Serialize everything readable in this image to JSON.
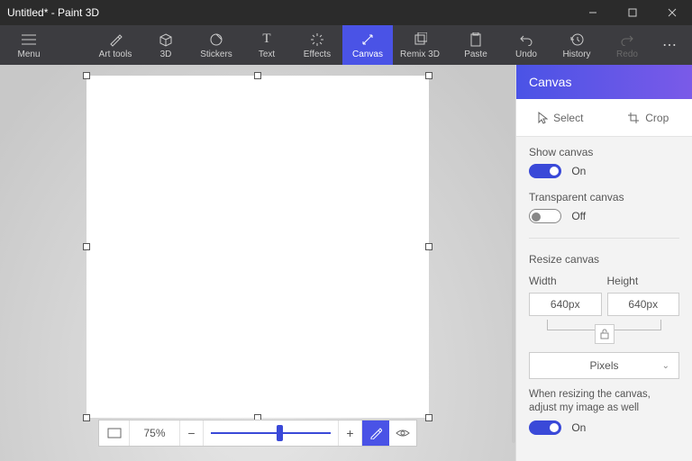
{
  "titlebar": {
    "title": "Untitled* - Paint 3D"
  },
  "ribbon": {
    "menu": "Menu",
    "art_tools": "Art tools",
    "three_d": "3D",
    "stickers": "Stickers",
    "text": "Text",
    "effects": "Effects",
    "canvas": "Canvas",
    "remix_3d": "Remix 3D",
    "paste": "Paste",
    "undo": "Undo",
    "history": "History",
    "redo": "Redo"
  },
  "zoom": {
    "percent": "75%",
    "minus": "−",
    "plus": "+"
  },
  "panel": {
    "title": "Canvas",
    "select": "Select",
    "crop": "Crop",
    "show_canvas_label": "Show canvas",
    "show_canvas_state": "On",
    "transparent_label": "Transparent canvas",
    "transparent_state": "Off",
    "resize_label": "Resize canvas",
    "width_label": "Width",
    "height_label": "Height",
    "width_value": "640px",
    "height_value": "640px",
    "units": "Pixels",
    "hint": "When resizing the canvas, adjust my image as well",
    "hint_state": "On"
  }
}
